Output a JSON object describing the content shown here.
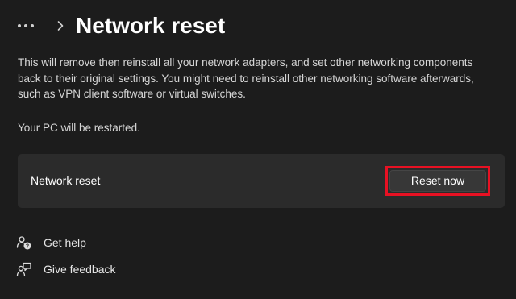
{
  "header": {
    "title": "Network reset",
    "more_icon": "more-horizontal-icon",
    "separator_icon": "chevron-right-icon"
  },
  "main": {
    "description": "This will remove then reinstall all your network adapters, and set other networking components back to their original settings. You might need to reinstall other networking software afterwards, such as VPN client software or virtual switches.",
    "restart_note": "Your PC will be restarted.",
    "card": {
      "label": "Network reset",
      "button_label": "Reset now",
      "highlight_color": "#e81123"
    }
  },
  "links": [
    {
      "label": "Get help",
      "icon": "help-icon"
    },
    {
      "label": "Give feedback",
      "icon": "feedback-icon"
    }
  ],
  "colors": {
    "background": "#1c1c1c",
    "card": "#2b2b2b",
    "button": "#373737"
  }
}
